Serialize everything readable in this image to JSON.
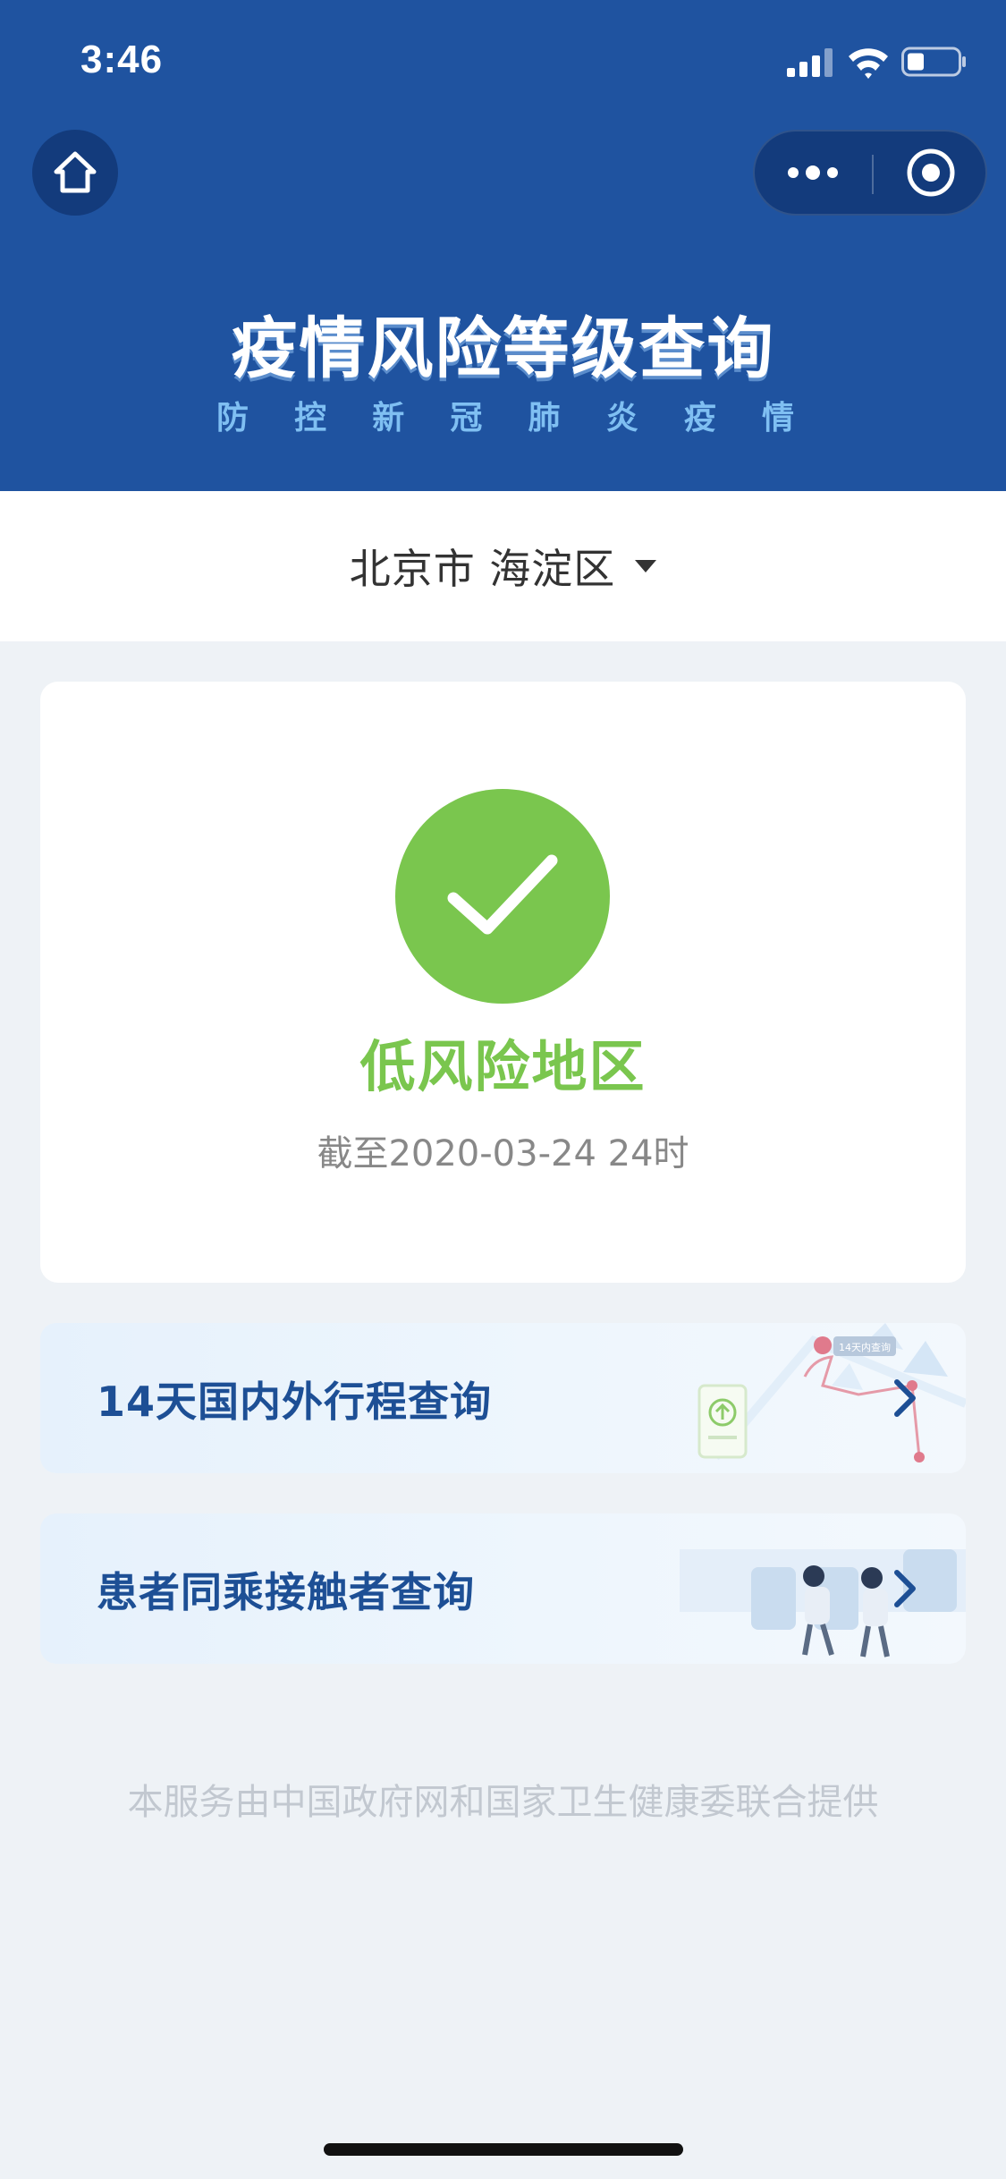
{
  "status_bar": {
    "time": "3:46",
    "icons": [
      "signal-icon",
      "wifi-icon",
      "battery-icon"
    ]
  },
  "nav": {
    "home_icon": "home-icon",
    "more_icon": "more-dots-icon",
    "close_icon": "target-close-icon"
  },
  "header": {
    "title": "疫情风险等级查询",
    "subtitle_chars": [
      "防",
      "控",
      "新",
      "冠",
      "肺",
      "炎",
      "疫",
      "情"
    ]
  },
  "region": {
    "label": "北京市 海淀区",
    "dropdown_icon": "caret-down-icon"
  },
  "result": {
    "icon": "check-icon",
    "level": "低风险地区",
    "as_of": "截至2020-03-24 24时"
  },
  "queries": [
    {
      "label": "14天国内外行程查询",
      "badge_text": "14天内查询",
      "icon": "chevron-right-icon"
    },
    {
      "label": "患者同乘接触者查询",
      "icon": "chevron-right-icon"
    }
  ],
  "footer": {
    "note": "本服务由中国政府网和国家卫生健康委联合提供"
  },
  "colors": {
    "header_bg": "#1f53a0",
    "accent_green": "#7ac64e",
    "link_blue": "#1d4f95",
    "page_bg": "#eef2f6"
  }
}
